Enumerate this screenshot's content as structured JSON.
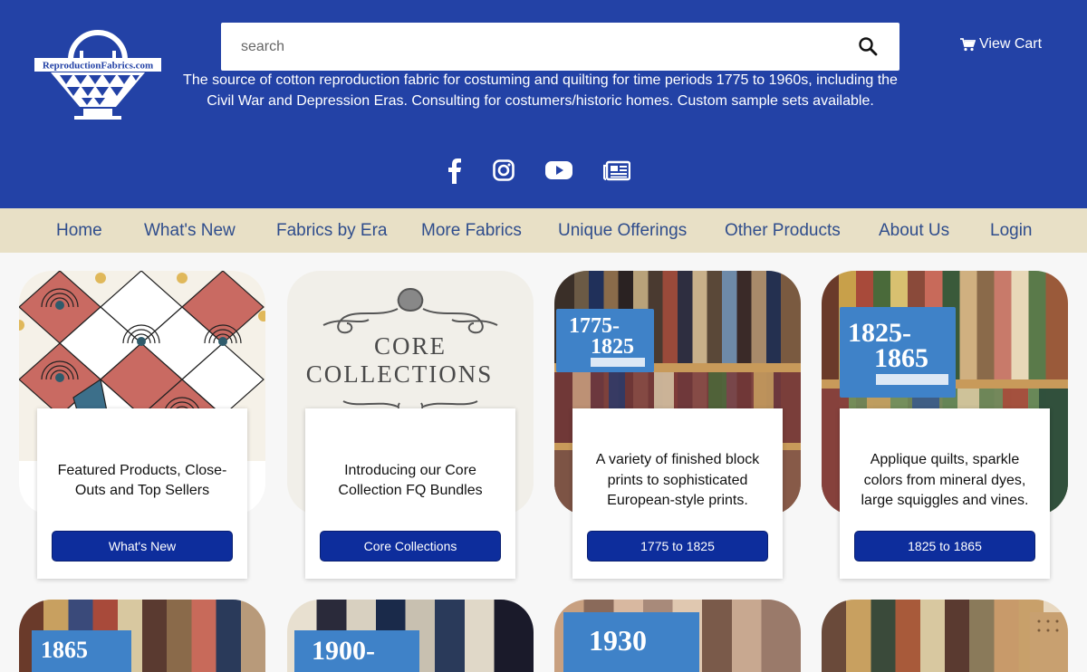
{
  "header": {
    "logo_text": "ReproductionFabrics.com",
    "search_placeholder": "search",
    "cart_label": "View Cart",
    "tagline": "The source of cotton reproduction fabric for costuming and quilting for time periods 1775 to 1960s, including the Civil War and Depression Eras. Consulting for costumers/historic homes. Custom sample sets available.",
    "social": [
      "facebook-icon",
      "instagram-icon",
      "youtube-icon",
      "newsletter-icon"
    ]
  },
  "nav": {
    "items": [
      "Home",
      "What's New",
      "Fabrics by Era",
      "More Fabrics",
      "Unique Offerings",
      "Other Products",
      "About Us",
      "Login"
    ]
  },
  "cards": [
    {
      "desc": "Featured Products, Close-Outs and Top Sellers",
      "button": "What's New"
    },
    {
      "desc": "Introducing our Core Collection FQ Bundles",
      "button": "Core Collections",
      "image_text": [
        "CORE",
        "COLLECTIONS"
      ]
    },
    {
      "desc": "A variety of finished block prints to sophisticated European-style prints.",
      "button": "1775 to 1825",
      "sign": [
        "1775-",
        "1825"
      ]
    },
    {
      "desc": "Applique quilts, sparkle colors from mineral dyes, large squiggles and vines.",
      "button": "1825 to 1865",
      "sign": [
        "1825-",
        "1865"
      ]
    }
  ],
  "row2_signs": [
    "1865",
    "1900-",
    "1930",
    ""
  ],
  "colors": {
    "header_bg": "#2342a6",
    "nav_bg": "#e8e0c6",
    "nav_text": "#2f4d8c",
    "button_bg": "#0d2d9c"
  }
}
